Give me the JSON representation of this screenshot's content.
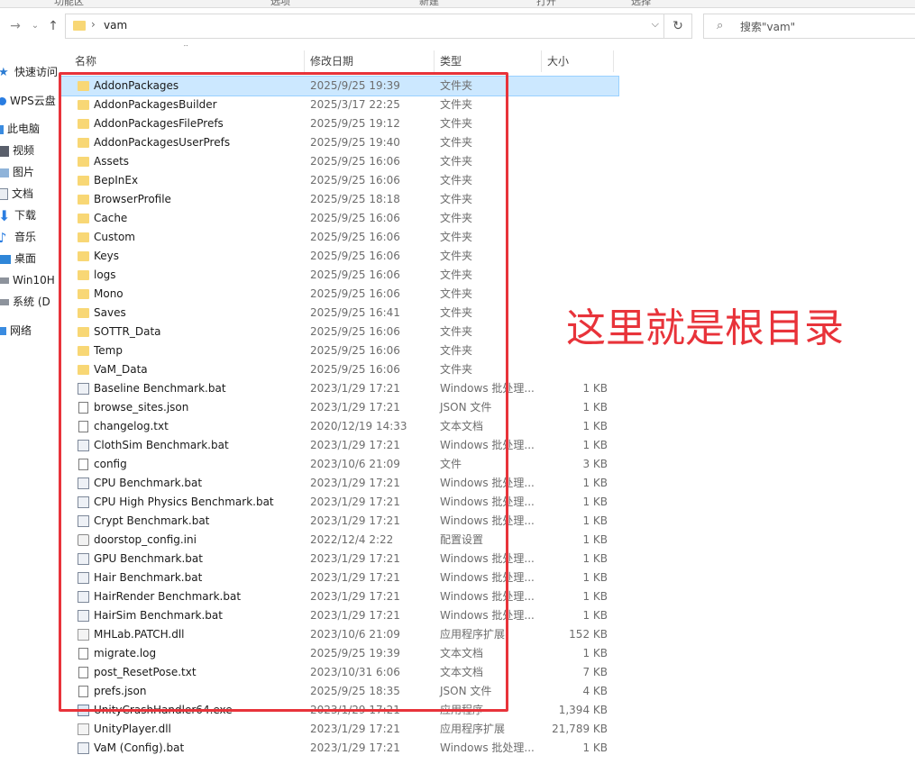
{
  "ribbon": [
    "功能区",
    "选项",
    "新建",
    "打开",
    "选择"
  ],
  "addressbar": {
    "path": "vam",
    "separator": "›"
  },
  "search": {
    "placeholder": "搜索\"vam\""
  },
  "sidebar": {
    "items": [
      {
        "label": "快速访问",
        "icon": "star-icon"
      },
      {
        "label": "WPS云盘",
        "icon": "cloud-icon"
      },
      {
        "label": "此电脑",
        "icon": "computer-icon"
      },
      {
        "label": "视频",
        "icon": "video-icon"
      },
      {
        "label": "图片",
        "icon": "image-icon"
      },
      {
        "label": "文档",
        "icon": "document-icon"
      },
      {
        "label": "下载",
        "icon": "download-icon"
      },
      {
        "label": "音乐",
        "icon": "music-icon"
      },
      {
        "label": "桌面",
        "icon": "desktop-icon"
      },
      {
        "label": "Win10H",
        "icon": "drive-icon"
      },
      {
        "label": "系统 (D",
        "icon": "drive-icon"
      },
      {
        "label": "网络",
        "icon": "network-icon"
      }
    ]
  },
  "columns": {
    "name": "名称",
    "date": "修改日期",
    "type": "类型",
    "size": "大小"
  },
  "files": [
    {
      "name": "AddonPackages",
      "date": "2025/9/25 19:39",
      "type": "文件夹",
      "size": "",
      "icon": "folder"
    },
    {
      "name": "AddonPackagesBuilder",
      "date": "2025/3/17 22:25",
      "type": "文件夹",
      "size": "",
      "icon": "folder"
    },
    {
      "name": "AddonPackagesFilePrefs",
      "date": "2025/9/25 19:12",
      "type": "文件夹",
      "size": "",
      "icon": "folder"
    },
    {
      "name": "AddonPackagesUserPrefs",
      "date": "2025/9/25 19:40",
      "type": "文件夹",
      "size": "",
      "icon": "folder"
    },
    {
      "name": "Assets",
      "date": "2025/9/25 16:06",
      "type": "文件夹",
      "size": "",
      "icon": "folder"
    },
    {
      "name": "BepInEx",
      "date": "2025/9/25 16:06",
      "type": "文件夹",
      "size": "",
      "icon": "folder"
    },
    {
      "name": "BrowserProfile",
      "date": "2025/9/25 18:18",
      "type": "文件夹",
      "size": "",
      "icon": "folder"
    },
    {
      "name": "Cache",
      "date": "2025/9/25 16:06",
      "type": "文件夹",
      "size": "",
      "icon": "folder"
    },
    {
      "name": "Custom",
      "date": "2025/9/25 16:06",
      "type": "文件夹",
      "size": "",
      "icon": "folder"
    },
    {
      "name": "Keys",
      "date": "2025/9/25 16:06",
      "type": "文件夹",
      "size": "",
      "icon": "folder"
    },
    {
      "name": "logs",
      "date": "2025/9/25 16:06",
      "type": "文件夹",
      "size": "",
      "icon": "folder"
    },
    {
      "name": "Mono",
      "date": "2025/9/25 16:06",
      "type": "文件夹",
      "size": "",
      "icon": "folder"
    },
    {
      "name": "Saves",
      "date": "2025/9/25 16:41",
      "type": "文件夹",
      "size": "",
      "icon": "folder"
    },
    {
      "name": "SOTTR_Data",
      "date": "2025/9/25 16:06",
      "type": "文件夹",
      "size": "",
      "icon": "folder"
    },
    {
      "name": "Temp",
      "date": "2025/9/25 16:06",
      "type": "文件夹",
      "size": "",
      "icon": "folder"
    },
    {
      "name": "VaM_Data",
      "date": "2025/9/25 16:06",
      "type": "文件夹",
      "size": "",
      "icon": "folder"
    },
    {
      "name": "Baseline Benchmark.bat",
      "date": "2023/1/29 17:21",
      "type": "Windows 批处理...",
      "size": "1 KB",
      "icon": "bat"
    },
    {
      "name": "browse_sites.json",
      "date": "2023/1/29 17:21",
      "type": "JSON 文件",
      "size": "1 KB",
      "icon": "file"
    },
    {
      "name": "changelog.txt",
      "date": "2020/12/19 14:33",
      "type": "文本文档",
      "size": "1 KB",
      "icon": "file"
    },
    {
      "name": "ClothSim Benchmark.bat",
      "date": "2023/1/29 17:21",
      "type": "Windows 批处理...",
      "size": "1 KB",
      "icon": "bat"
    },
    {
      "name": "config",
      "date": "2023/10/6 21:09",
      "type": "文件",
      "size": "3 KB",
      "icon": "file"
    },
    {
      "name": "CPU Benchmark.bat",
      "date": "2023/1/29 17:21",
      "type": "Windows 批处理...",
      "size": "1 KB",
      "icon": "bat"
    },
    {
      "name": "CPU High Physics Benchmark.bat",
      "date": "2023/1/29 17:21",
      "type": "Windows 批处理...",
      "size": "1 KB",
      "icon": "bat"
    },
    {
      "name": "Crypt Benchmark.bat",
      "date": "2023/1/29 17:21",
      "type": "Windows 批处理...",
      "size": "1 KB",
      "icon": "bat"
    },
    {
      "name": "doorstop_config.ini",
      "date": "2022/12/4 2:22",
      "type": "配置设置",
      "size": "1 KB",
      "icon": "gear"
    },
    {
      "name": "GPU Benchmark.bat",
      "date": "2023/1/29 17:21",
      "type": "Windows 批处理...",
      "size": "1 KB",
      "icon": "bat"
    },
    {
      "name": "Hair Benchmark.bat",
      "date": "2023/1/29 17:21",
      "type": "Windows 批处理...",
      "size": "1 KB",
      "icon": "bat"
    },
    {
      "name": "HairRender Benchmark.bat",
      "date": "2023/1/29 17:21",
      "type": "Windows 批处理...",
      "size": "1 KB",
      "icon": "bat"
    },
    {
      "name": "HairSim Benchmark.bat",
      "date": "2023/1/29 17:21",
      "type": "Windows 批处理...",
      "size": "1 KB",
      "icon": "bat"
    },
    {
      "name": "MHLab.PATCH.dll",
      "date": "2023/10/6 21:09",
      "type": "应用程序扩展",
      "size": "152 KB",
      "icon": "dll"
    },
    {
      "name": "migrate.log",
      "date": "2025/9/25 19:39",
      "type": "文本文档",
      "size": "1 KB",
      "icon": "file"
    },
    {
      "name": "post_ResetPose.txt",
      "date": "2023/10/31 6:06",
      "type": "文本文档",
      "size": "7 KB",
      "icon": "file"
    },
    {
      "name": "prefs.json",
      "date": "2025/9/25 18:35",
      "type": "JSON 文件",
      "size": "4 KB",
      "icon": "file"
    },
    {
      "name": "UnityCrashHandler64.exe",
      "date": "2023/1/29 17:21",
      "type": "应用程序",
      "size": "1,394 KB",
      "icon": "exe"
    },
    {
      "name": "UnityPlayer.dll",
      "date": "2023/1/29 17:21",
      "type": "应用程序扩展",
      "size": "21,789 KB",
      "icon": "dll"
    },
    {
      "name": "VaM (Config).bat",
      "date": "2023/1/29 17:21",
      "type": "Windows 批处理...",
      "size": "1 KB",
      "icon": "bat"
    }
  ],
  "annotation": {
    "text": "这里就是根目录",
    "color": "#e8333a"
  },
  "colors": {
    "selection": "#cce8ff",
    "folder": "#f8d775"
  }
}
